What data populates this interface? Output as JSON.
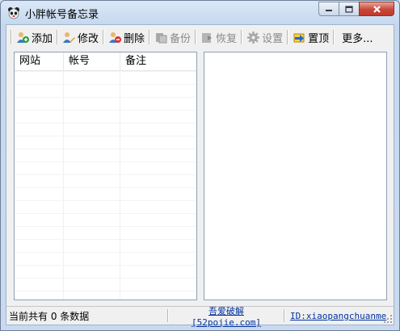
{
  "window": {
    "title": "小胖帐号备忘录"
  },
  "toolbar": {
    "add": "添加",
    "edit": "修改",
    "delete": "删除",
    "backup": "备份",
    "restore": "恢复",
    "settings": "设置",
    "top": "置顶",
    "more": "更多..."
  },
  "table": {
    "columns": [
      "网站",
      "帐号",
      "备注"
    ]
  },
  "status": {
    "count": "当前共有 0 条数据",
    "link1": "吾爱破解 [52pojie.com]",
    "link2": "ID:xiaopangchuanme"
  },
  "colors": {
    "link": "#0033a0",
    "disabled": "#8a8a8a"
  }
}
